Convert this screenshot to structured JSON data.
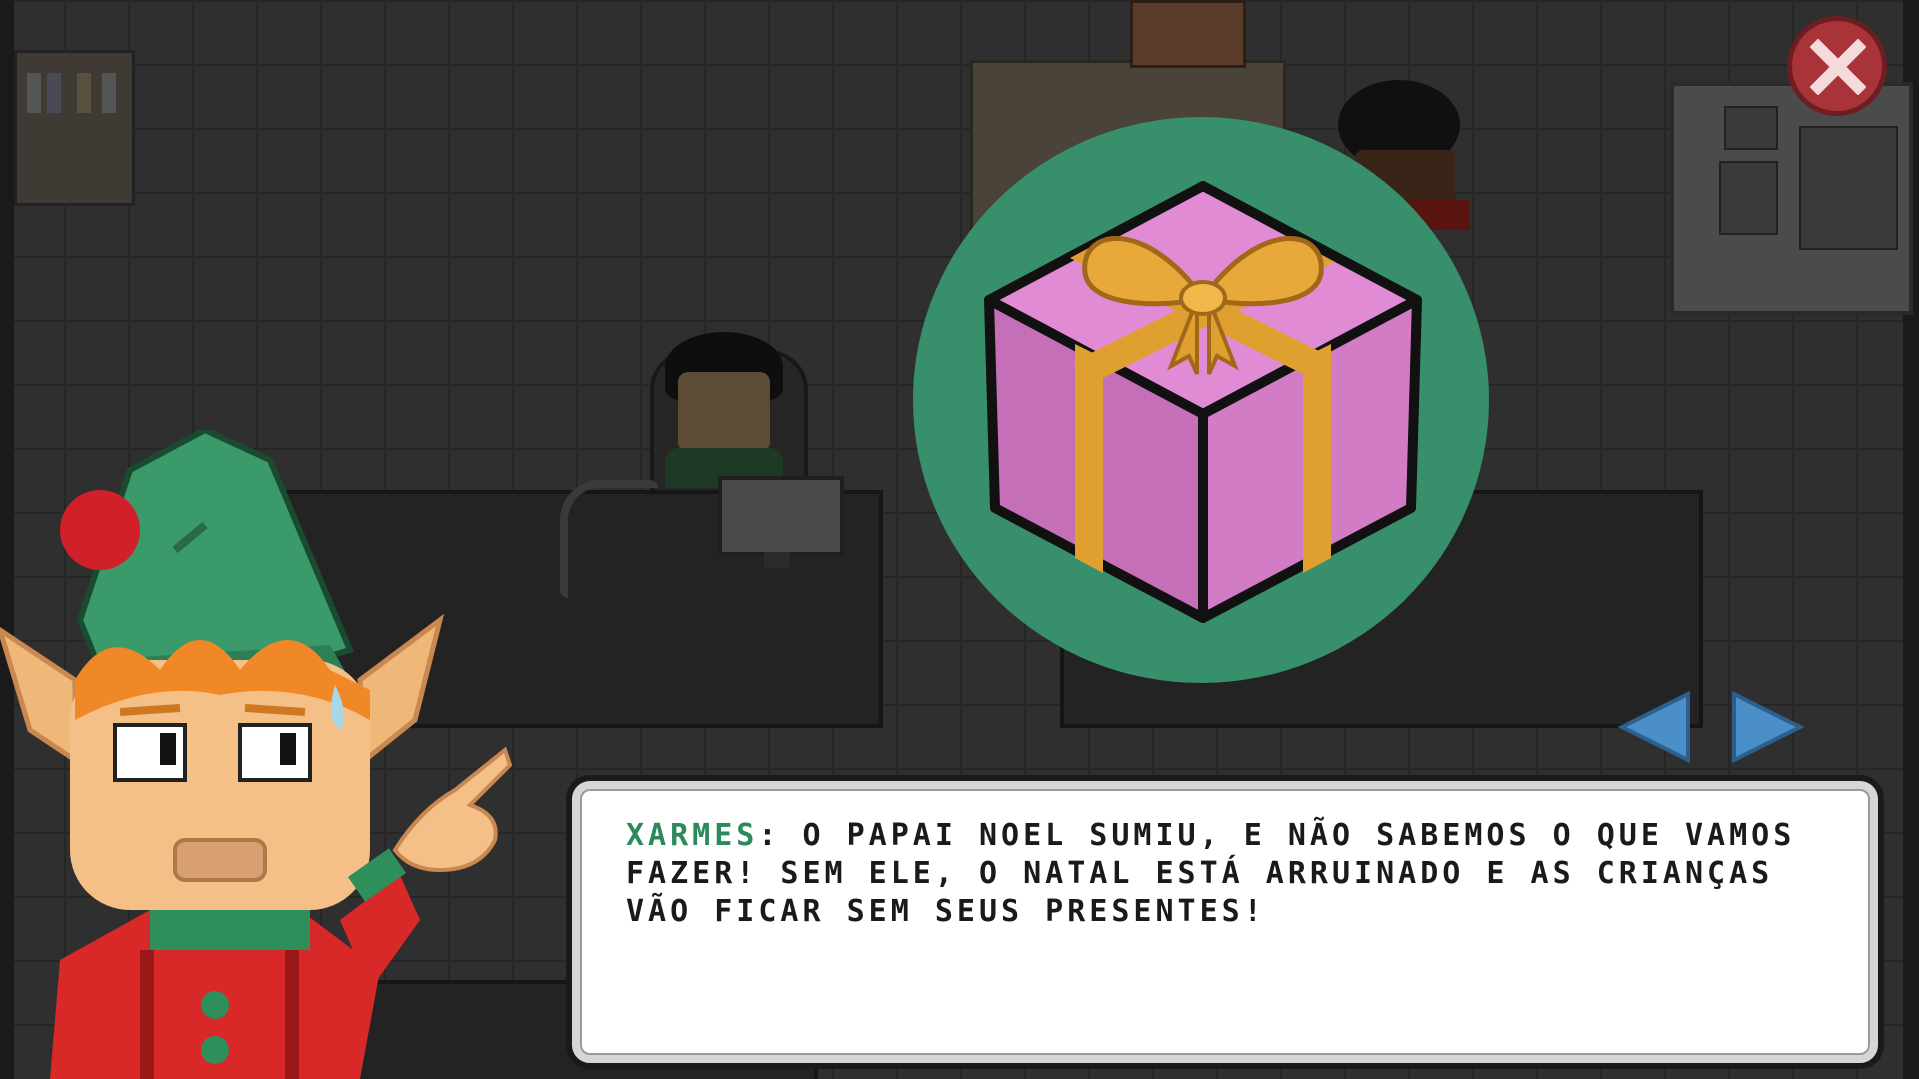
{
  "dialog": {
    "speaker": "XARMES",
    "separator": ": ",
    "text": "O PAPAI NOEL SUMIU, E NÃO SABEMOS O QUE VAMOS FAZER! SEM ELE, O NATAL ESTÁ ARRUINADO E AS CRIANÇAS VÃO FICAR SEM SEUS PRESENTES!"
  },
  "controls": {
    "close": "close-icon",
    "previous": "arrow-left-icon",
    "next": "arrow-right-icon"
  },
  "item": {
    "icon": "gift-box-icon"
  },
  "colors": {
    "circle": "#37906b",
    "gift": "#d27cc5",
    "ribbon": "#e0a030",
    "speaker": "#2a8a5a",
    "close": "#a8343a",
    "arrow": "#4a8fc8"
  }
}
